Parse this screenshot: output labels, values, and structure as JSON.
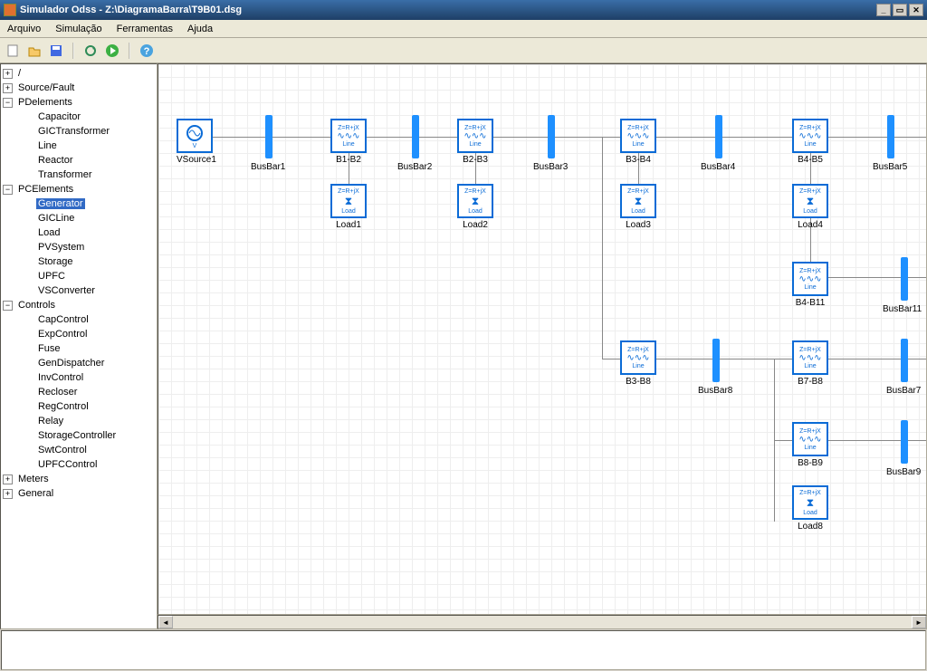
{
  "title": "Simulador Odss - Z:\\DiagramaBarra\\T9B01.dsg",
  "menu": {
    "arquivo": "Arquivo",
    "simulacao": "Simulação",
    "ferramentas": "Ferramentas",
    "ajuda": "Ajuda"
  },
  "tree": {
    "root": "/",
    "source_fault": "Source/Fault",
    "pdelements": "PDelements",
    "pd": {
      "capacitor": "Capacitor",
      "gictransformer": "GICTransformer",
      "line": "Line",
      "reactor": "Reactor",
      "transformer": "Transformer"
    },
    "pcelements": "PCElements",
    "pc": {
      "generator": "Generator",
      "gicline": "GICLine",
      "load": "Load",
      "pvsystem": "PVSystem",
      "storage": "Storage",
      "upfc": "UPFC",
      "vsconverter": "VSConverter"
    },
    "controls": "Controls",
    "ct": {
      "capcontrol": "CapControl",
      "expcontrol": "ExpControl",
      "fuse": "Fuse",
      "gendispatcher": "GenDispatcher",
      "invcontrol": "InvControl",
      "recloser": "Recloser",
      "regcontrol": "RegControl",
      "relay": "Relay",
      "storagecontroller": "StorageController",
      "swtcontrol": "SwtControl",
      "upfccontrol": "UPFCControl"
    },
    "meters": "Meters",
    "general": "General"
  },
  "diagram": {
    "z_label": "Z=R+jX",
    "line_lbl": "Line",
    "load_lbl": "Load",
    "vsource": "VSource1",
    "busbar1": "BusBar1",
    "busbar2": "BusBar2",
    "busbar3": "BusBar3",
    "busbar4": "BusBar4",
    "busbar5": "BusBar5",
    "busbar7": "BusBar7",
    "busbar8": "BusBar8",
    "busbar9": "BusBar9",
    "busbar11": "BusBar11",
    "b1b2": "B1-B2",
    "b2b3": "B2-B3",
    "b3b4": "B3-B4",
    "b4b5": "B4-B5",
    "b4b11": "B4-B11",
    "b3b8": "B3-B8",
    "b7b8": "B7-B8",
    "b8b9": "B8-B9",
    "load1": "Load1",
    "load2": "Load2",
    "load3": "Load3",
    "load4": "Load4",
    "load8": "Load8"
  }
}
